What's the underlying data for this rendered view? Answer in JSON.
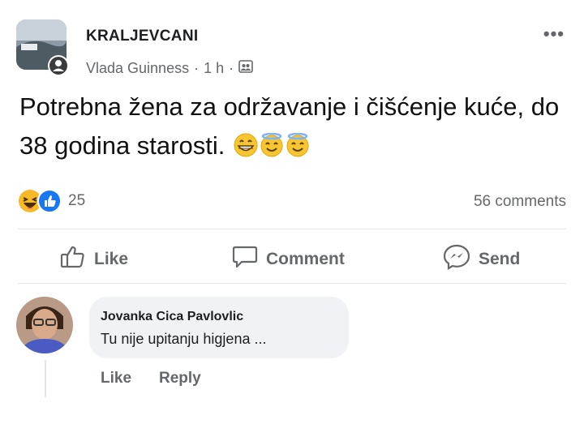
{
  "post": {
    "group_name": "KRALJEVCANI",
    "author": "Vlada Guinness",
    "time": "1 h",
    "separator": "·",
    "text": "Potrebna žena za održavanje i čišćenje kuće, do 38 godina starosti.",
    "emojis": [
      "grinning-face-icon",
      "smiling-face-with-halo-icon",
      "smiling-face-with-halo-icon"
    ],
    "more_label": "•••"
  },
  "stats": {
    "reaction_icons": [
      "haha-reaction-icon",
      "like-reaction-icon"
    ],
    "reaction_count": "25",
    "comments_count": "56 comments"
  },
  "actions": {
    "like_label": "Like",
    "comment_label": "Comment",
    "send_label": "Send"
  },
  "comment": {
    "author": "Jovanka Cica Pavlovlic",
    "text": "Tu nije upitanju higjena ...",
    "like_label": "Like",
    "reply_label": "Reply"
  },
  "colors": {
    "like_blue": "#1877f2",
    "reaction_yellow": "#f7b928",
    "secondary_text": "#65676b",
    "bubble_bg": "#f0f2f5"
  }
}
